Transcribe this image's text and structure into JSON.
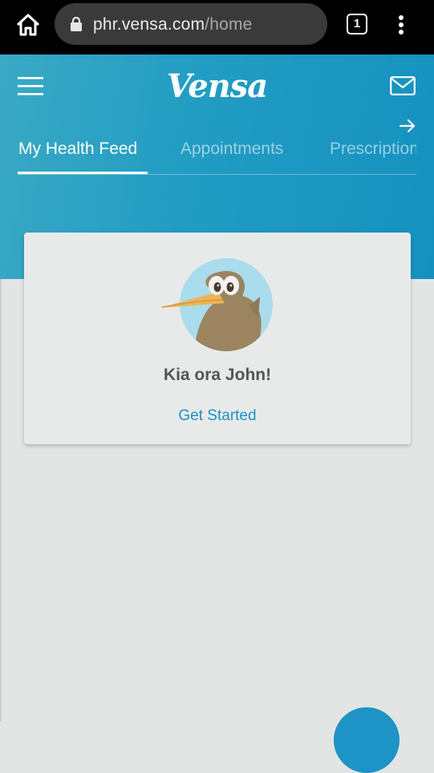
{
  "browser": {
    "url_host": "phr.vensa.com",
    "url_path": "/home",
    "tab_count": "1",
    "icons": [
      "home-icon",
      "lock-icon",
      "tab-switcher-icon",
      "more-vert-icon"
    ]
  },
  "header": {
    "brand": "Vensa",
    "icons": [
      "hamburger-menu-icon",
      "mail-icon",
      "arrow-right-icon"
    ],
    "tabs": [
      {
        "label": "My Health Feed",
        "active": true
      },
      {
        "label": "Appointments",
        "active": false
      },
      {
        "label": "Prescriptions",
        "active": false
      }
    ],
    "accent_color": "#219cc3"
  },
  "card": {
    "greeting": "Kia ora John!",
    "action_label": "Get Started",
    "avatar": "kiwi-bird-avatar"
  },
  "fab": {
    "icon": "add-fab",
    "color": "#1d93c6"
  }
}
